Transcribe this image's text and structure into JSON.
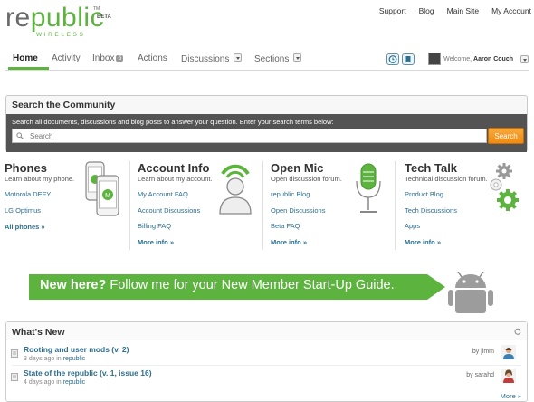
{
  "logo": {
    "wordmark_a": "re",
    "wordmark_b": "public",
    "tm": "TM",
    "beta": "BETA",
    "sub": "WIRELESS"
  },
  "topnav": [
    "Support",
    "Blog",
    "Main Site",
    "My Account"
  ],
  "tabs": {
    "home": "Home",
    "activity": "Activity",
    "inbox": "Inbox",
    "inbox_count": "6",
    "actions": "Actions",
    "discussions": "Discussions",
    "sections": "Sections"
  },
  "user": {
    "welcome": "Welcome,",
    "name": "Aaron Couch"
  },
  "search": {
    "title": "Search the Community",
    "description": "Search all documents, discussions and blog posts to answer your question. Enter your search terms below:",
    "placeholder": "Search",
    "button": "Search"
  },
  "categories": [
    {
      "title": "Phones",
      "subtitle": "Learn about my phone.",
      "links": [
        "Motorola DEFY",
        "LG Optimus"
      ],
      "more": "All phones »"
    },
    {
      "title": "Account Info",
      "subtitle": "Learn about my account.",
      "links": [
        "My Account FAQ",
        "Account Discussions",
        "Billing FAQ"
      ],
      "more": "More info »"
    },
    {
      "title": "Open Mic",
      "subtitle": "Open discussion forum.",
      "links": [
        "republic Blog",
        "Open Discussions",
        "Beta FAQ"
      ],
      "more": "More info »"
    },
    {
      "title": "Tech Talk",
      "subtitle": "Technical discussion forum.",
      "links": [
        "Product Blog",
        "Tech Discussions",
        "Apps"
      ],
      "more": "More info »"
    }
  ],
  "banner": {
    "bold": "New here?",
    "rest": " Follow me for your New Member Start-Up Guide."
  },
  "whats_new": {
    "title": "What's New",
    "items": [
      {
        "title": "Rooting and user mods (v. 2)",
        "age": "3 days ago",
        "in_label": "in",
        "place": "republic",
        "by": "by jimm"
      },
      {
        "title": "State of the republic (v. 1, issue 16)",
        "age": "4 days ago",
        "in_label": "in",
        "place": "republic",
        "by": "by sarahd"
      }
    ],
    "more": "More »"
  },
  "colors": {
    "brand_green": "#5cb33d",
    "link_blue": "#2c6e8f",
    "search_orange": "#ef8b12",
    "dark_bar": "#535353"
  }
}
